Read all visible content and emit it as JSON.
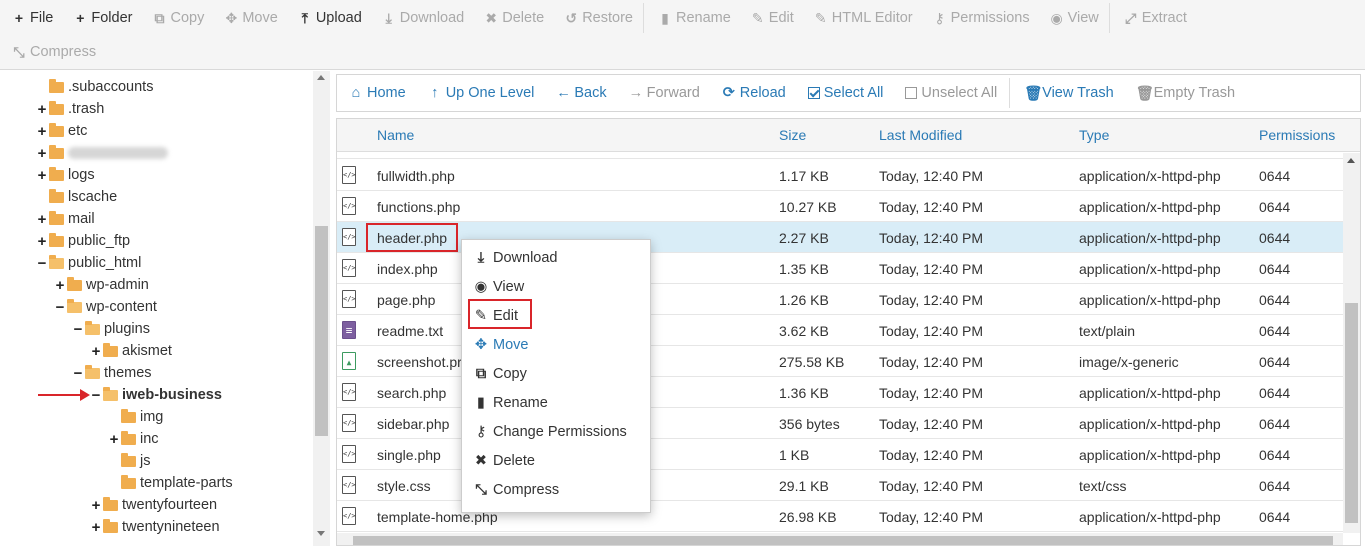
{
  "toolbar": {
    "row1": [
      {
        "icon": "plus-icon",
        "glyph": "+",
        "label": "File",
        "enabled": true
      },
      {
        "icon": "plus-icon",
        "glyph": "+",
        "label": "Folder",
        "enabled": true
      },
      {
        "icon": "copy-icon",
        "glyph": "⧉",
        "label": "Copy",
        "enabled": false
      },
      {
        "icon": "move-icon",
        "glyph": "✥",
        "label": "Move",
        "enabled": false
      },
      {
        "icon": "upload-icon",
        "glyph": "⤒",
        "label": "Upload",
        "enabled": true
      },
      {
        "icon": "download-icon",
        "glyph": "⤓",
        "label": "Download",
        "enabled": false
      },
      {
        "icon": "delete-icon",
        "glyph": "✖",
        "label": "Delete",
        "enabled": false
      },
      {
        "icon": "restore-icon",
        "glyph": "↺",
        "label": "Restore",
        "enabled": false
      },
      {
        "icon": "rename-icon",
        "glyph": "▮",
        "label": "Rename",
        "enabled": false
      },
      {
        "icon": "pencil-icon",
        "glyph": "✎",
        "label": "Edit",
        "enabled": false
      },
      {
        "icon": "html-editor-icon",
        "glyph": "✎",
        "label": "HTML Editor",
        "enabled": false
      },
      {
        "icon": "key-icon",
        "glyph": "⚷",
        "label": "Permissions",
        "enabled": false
      },
      {
        "icon": "eye-icon",
        "glyph": "◉",
        "label": "View",
        "enabled": false
      },
      {
        "icon": "extract-icon",
        "glyph": "⤢",
        "label": "Extract",
        "enabled": false
      }
    ],
    "row2": [
      {
        "icon": "compress-icon",
        "glyph": "⤡",
        "label": "Compress",
        "enabled": false
      }
    ]
  },
  "tree": [
    {
      "label": ".subaccounts",
      "toggle": "",
      "level": 0,
      "open": false,
      "bold": false,
      "blurred": false
    },
    {
      "label": ".trash",
      "toggle": "+",
      "level": 0,
      "open": false,
      "bold": false,
      "blurred": false
    },
    {
      "label": "etc",
      "toggle": "+",
      "level": 0,
      "open": false,
      "bold": false,
      "blurred": false
    },
    {
      "label": "",
      "toggle": "+",
      "level": 0,
      "open": false,
      "bold": false,
      "blurred": true
    },
    {
      "label": "logs",
      "toggle": "+",
      "level": 0,
      "open": false,
      "bold": false,
      "blurred": false
    },
    {
      "label": "lscache",
      "toggle": "",
      "level": 0,
      "open": false,
      "bold": false,
      "blurred": false
    },
    {
      "label": "mail",
      "toggle": "+",
      "level": 0,
      "open": false,
      "bold": false,
      "blurred": false
    },
    {
      "label": "public_ftp",
      "toggle": "+",
      "level": 0,
      "open": false,
      "bold": false,
      "blurred": false
    },
    {
      "label": "public_html",
      "toggle": "−",
      "level": 0,
      "open": true,
      "bold": false,
      "blurred": false
    },
    {
      "label": "wp-admin",
      "toggle": "+",
      "level": 1,
      "open": false,
      "bold": false,
      "blurred": false
    },
    {
      "label": "wp-content",
      "toggle": "−",
      "level": 1,
      "open": true,
      "bold": false,
      "blurred": false
    },
    {
      "label": "plugins",
      "toggle": "−",
      "level": 2,
      "open": true,
      "bold": false,
      "blurred": false
    },
    {
      "label": "akismet",
      "toggle": "+",
      "level": 3,
      "open": false,
      "bold": false,
      "blurred": false
    },
    {
      "label": "themes",
      "toggle": "−",
      "level": 2,
      "open": true,
      "bold": false,
      "blurred": false
    },
    {
      "label": "iweb-business",
      "toggle": "−",
      "level": 3,
      "open": true,
      "bold": true,
      "blurred": false
    },
    {
      "label": "img",
      "toggle": "",
      "level": 4,
      "open": false,
      "bold": false,
      "blurred": false
    },
    {
      "label": "inc",
      "toggle": "+",
      "level": 4,
      "open": false,
      "bold": false,
      "blurred": false
    },
    {
      "label": "js",
      "toggle": "",
      "level": 4,
      "open": false,
      "bold": false,
      "blurred": false
    },
    {
      "label": "template-parts",
      "toggle": "",
      "level": 4,
      "open": false,
      "bold": false,
      "blurred": false
    },
    {
      "label": "twentyfourteen",
      "toggle": "+",
      "level": 3,
      "open": false,
      "bold": false,
      "blurred": false
    },
    {
      "label": "twentynineteen",
      "toggle": "+",
      "level": 3,
      "open": false,
      "bold": false,
      "blurred": false
    }
  ],
  "nav": [
    {
      "icon": "home-icon",
      "glyph": "⌂",
      "label": "Home",
      "enabled": true
    },
    {
      "icon": "up-level-icon",
      "glyph": "↑",
      "label": "Up One Level",
      "enabled": true
    },
    {
      "icon": "back-icon",
      "glyph": "←",
      "label": "Back",
      "enabled": true
    },
    {
      "icon": "forward-icon",
      "glyph": "→",
      "label": "Forward",
      "enabled": false
    },
    {
      "icon": "reload-icon",
      "glyph": "⟳",
      "label": "Reload",
      "enabled": true
    },
    {
      "icon": "select-all-icon",
      "glyph": "checkbox-on",
      "label": "Select All",
      "enabled": true
    },
    {
      "icon": "unselect-all-icon",
      "glyph": "checkbox-off",
      "label": "Unselect All",
      "enabled": false
    },
    {
      "icon": "trash-icon",
      "glyph": "🗑",
      "label": "View Trash",
      "enabled": true
    },
    {
      "icon": "trash-icon",
      "glyph": "🗑",
      "label": "Empty Trash",
      "enabled": false
    }
  ],
  "table": {
    "columns": [
      "Name",
      "Size",
      "Last Modified",
      "Type",
      "Permissions"
    ],
    "rows": [
      {
        "icon": "code",
        "name": "fullwidth.php",
        "size": "1.17 KB",
        "modified": "Today, 12:40 PM",
        "type": "application/x-httpd-php",
        "perms": "0644",
        "selected": false
      },
      {
        "icon": "code",
        "name": "functions.php",
        "size": "10.27 KB",
        "modified": "Today, 12:40 PM",
        "type": "application/x-httpd-php",
        "perms": "0644",
        "selected": false
      },
      {
        "icon": "code",
        "name": "header.php",
        "size": "2.27 KB",
        "modified": "Today, 12:40 PM",
        "type": "application/x-httpd-php",
        "perms": "0644",
        "selected": true
      },
      {
        "icon": "code",
        "name": "index.php",
        "size": "1.35 KB",
        "modified": "Today, 12:40 PM",
        "type": "application/x-httpd-php",
        "perms": "0644",
        "selected": false
      },
      {
        "icon": "code",
        "name": "page.php",
        "size": "1.26 KB",
        "modified": "Today, 12:40 PM",
        "type": "application/x-httpd-php",
        "perms": "0644",
        "selected": false
      },
      {
        "icon": "txt",
        "name": "readme.txt",
        "size": "3.62 KB",
        "modified": "Today, 12:40 PM",
        "type": "text/plain",
        "perms": "0644",
        "selected": false
      },
      {
        "icon": "img",
        "name": "screenshot.pr",
        "size": "275.58 KB",
        "modified": "Today, 12:40 PM",
        "type": "image/x-generic",
        "perms": "0644",
        "selected": false
      },
      {
        "icon": "code",
        "name": "search.php",
        "size": "1.36 KB",
        "modified": "Today, 12:40 PM",
        "type": "application/x-httpd-php",
        "perms": "0644",
        "selected": false
      },
      {
        "icon": "code",
        "name": "sidebar.php",
        "size": "356 bytes",
        "modified": "Today, 12:40 PM",
        "type": "application/x-httpd-php",
        "perms": "0644",
        "selected": false
      },
      {
        "icon": "code",
        "name": "single.php",
        "size": "1 KB",
        "modified": "Today, 12:40 PM",
        "type": "application/x-httpd-php",
        "perms": "0644",
        "selected": false
      },
      {
        "icon": "code",
        "name": "style.css",
        "size": "29.1 KB",
        "modified": "Today, 12:40 PM",
        "type": "text/css",
        "perms": "0644",
        "selected": false
      },
      {
        "icon": "code",
        "name": "template-home.php",
        "size": "26.98 KB",
        "modified": "Today, 12:40 PM",
        "type": "application/x-httpd-php",
        "perms": "0644",
        "selected": false
      }
    ]
  },
  "context_menu": [
    {
      "icon": "download-icon",
      "glyph": "⤓",
      "label": "Download",
      "highlight": false
    },
    {
      "icon": "eye-icon",
      "glyph": "◉",
      "label": "View",
      "highlight": false
    },
    {
      "icon": "pencil-icon",
      "glyph": "✎",
      "label": "Edit",
      "highlight": true
    },
    {
      "icon": "move-icon",
      "glyph": "✥",
      "label": "Move",
      "highlight": false
    },
    {
      "icon": "copy-icon",
      "glyph": "⧉",
      "label": "Copy",
      "highlight": false
    },
    {
      "icon": "rename-icon",
      "glyph": "▮",
      "label": "Rename",
      "highlight": false
    },
    {
      "icon": "key-icon",
      "glyph": "⚷",
      "label": "Change Permissions",
      "highlight": false
    },
    {
      "icon": "delete-icon",
      "glyph": "✖",
      "label": "Delete",
      "highlight": false
    },
    {
      "icon": "compress-icon",
      "glyph": "⤡",
      "label": "Compress",
      "highlight": false
    }
  ],
  "colors": {
    "link": "#2a7ab5",
    "highlight": "#d9252a",
    "selected_row": "#d9edf7",
    "folder": "#f0ad4e"
  }
}
